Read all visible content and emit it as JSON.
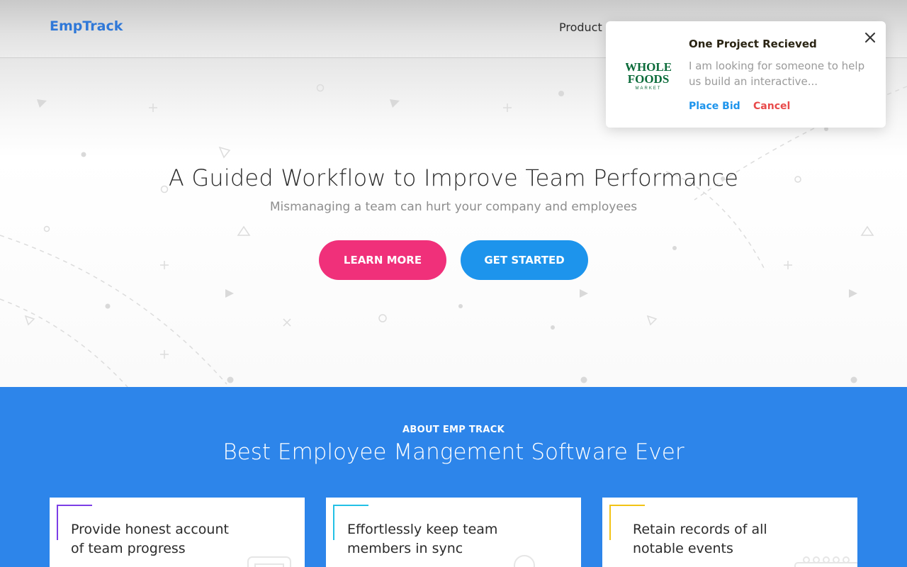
{
  "header": {
    "logo": "EmpTrack",
    "nav": {
      "product": "Product"
    }
  },
  "hero": {
    "title": "A Guided Workflow to Improve Team Performance",
    "subtitle": "Mismanaging a team can hurt your company and employees",
    "learn_more": "LEARN MORE",
    "get_started": "GET STARTED"
  },
  "about": {
    "kicker": "ABOUT EMP TRACK",
    "title": "Best Employee Mangement Software Ever",
    "cards": [
      {
        "line1": "Provide honest account",
        "line2": "of team progress",
        "accent": "#7c3ee6"
      },
      {
        "line1": "Effortlessly keep team",
        "line2": "members in sync",
        "accent": "#23c0e6"
      },
      {
        "line1": "Retain records of all",
        "line2": "notable events",
        "accent": "#f2c315"
      }
    ]
  },
  "notification": {
    "title": "One Project Recieved",
    "message": "I am looking for someone to help us build an interactive...",
    "place_bid": "Place Bid",
    "cancel": "Cancel",
    "logo": {
      "line1": "WHOLE",
      "line2": "FOODS",
      "line3": "MARKET"
    },
    "close_icon": "close-icon"
  },
  "colors": {
    "brand": "#2f78d8",
    "pink": "#f0307a",
    "blue": "#1d94ec",
    "about_bg": "#2d85ea",
    "cancel_red": "#e84a4a"
  }
}
